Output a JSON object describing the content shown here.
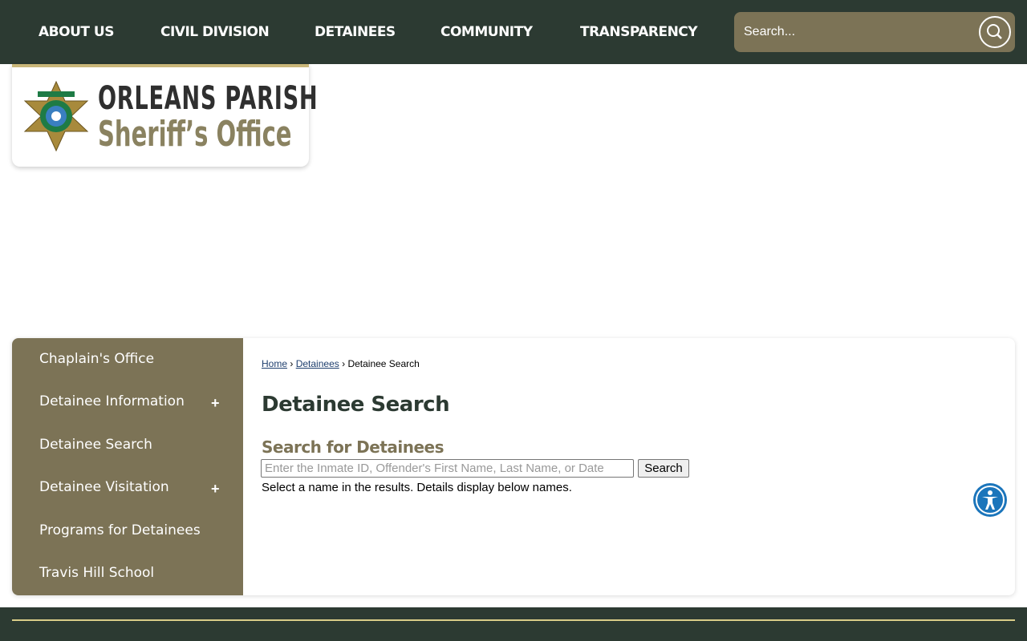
{
  "nav": {
    "items": [
      "ABOUT US",
      "CIVIL DIVISION",
      "DETAINEES",
      "COMMUNITY",
      "TRANSPARENCY"
    ],
    "search_placeholder": "Search..."
  },
  "logo": {
    "line1": "ORLEANS PARISH",
    "line2": "Sheriff’s Office"
  },
  "sidebar": {
    "items": [
      {
        "label": "Chaplain's Office"
      },
      {
        "label": "Detainee Information",
        "expand": "+"
      },
      {
        "label": "Detainee Search"
      },
      {
        "label": "Detainee Visitation",
        "expand": "+"
      },
      {
        "label": "Programs for Detainees"
      },
      {
        "label": "Travis Hill School"
      }
    ]
  },
  "breadcrumb": {
    "home": "Home",
    "sep": "›",
    "detainees": " Detainees",
    "current": "Detainee Search"
  },
  "main": {
    "title": "Detainee Search",
    "subtitle": "Search for Detainees",
    "input_placeholder": "Enter the Inmate ID, Offender's First Name, Last Name, or Date",
    "search_button": "Search",
    "hint": "Select a name in the results. Details display below names."
  }
}
